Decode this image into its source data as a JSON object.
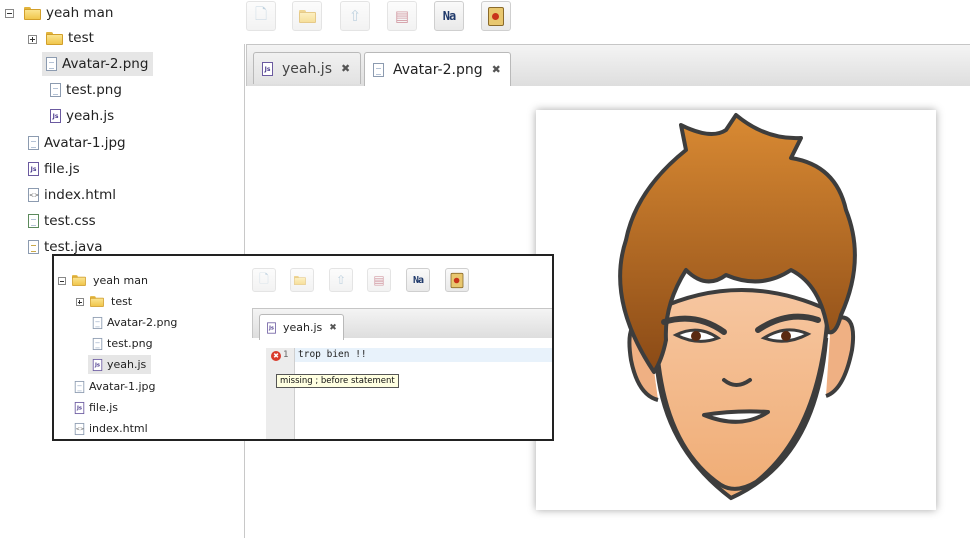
{
  "tree": {
    "root": {
      "label": "yeah man"
    },
    "folder_test": {
      "label": "test"
    },
    "items": [
      {
        "label": "Avatar-2.png"
      },
      {
        "label": "test.png"
      },
      {
        "label": "yeah.js"
      },
      {
        "label": "Avatar-1.jpg"
      },
      {
        "label": "file.js"
      },
      {
        "label": "index.html"
      },
      {
        "label": "test.css"
      },
      {
        "label": "test.java"
      }
    ]
  },
  "toolbar": {
    "buttons": [
      {
        "icon": "new-file-icon"
      },
      {
        "icon": "new-folder-icon"
      },
      {
        "icon": "upload-icon"
      },
      {
        "icon": "save-icon"
      },
      {
        "icon": "rename-icon",
        "text": "Na"
      },
      {
        "icon": "trash-icon"
      }
    ]
  },
  "editor": {
    "tabs": [
      {
        "label": "yeah.js",
        "close": "✖"
      },
      {
        "label": "Avatar-2.png",
        "close": "✖"
      }
    ],
    "preview": {
      "icon": "avatar-image"
    }
  },
  "inset": {
    "tree": {
      "root": "yeah man",
      "folder": "test",
      "items": [
        "Avatar-2.png",
        "test.png",
        "yeah.js",
        "Avatar-1.jpg",
        "file.js",
        "index.html"
      ]
    },
    "rename_text": "Na",
    "tab": {
      "label": "yeah.js",
      "close": "✖"
    },
    "code": {
      "line_number": "1",
      "text": "trop bien !!",
      "error_mark": "✖"
    },
    "tooltip": "missing ; before statement"
  },
  "colors": {
    "folder": "#f0c64c",
    "selection": "#e6e6e6",
    "error": "#d93a2a",
    "tooltip_bg": "#ffffe1",
    "hair": "#b5651d",
    "skin": "#f2b98a"
  }
}
